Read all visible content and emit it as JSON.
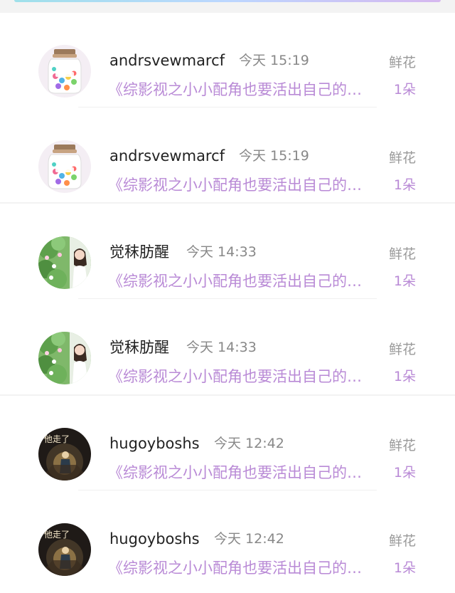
{
  "messages": [
    {
      "user": "andrsvewmarcf",
      "time": "今天 15:19",
      "gift_label": "鲜花",
      "book_title": "《综影视之小小配角也要活出自己的…",
      "count": "1朵",
      "avatar": "candy-jar-avatar"
    },
    {
      "user": "andrsvewmarcf",
      "time": "今天 15:19",
      "gift_label": "鲜花",
      "book_title": "《综影视之小小配角也要活出自己的…",
      "count": "1朵",
      "avatar": "candy-jar-avatar"
    },
    {
      "user": "觉秣肪醒",
      "time": "今天 14:33",
      "gift_label": "鲜花",
      "book_title": "《综影视之小小配角也要活出自己的…",
      "count": "1朵",
      "avatar": "girl-flowers-avatar"
    },
    {
      "user": "觉秣肪醒",
      "time": "今天 14:33",
      "gift_label": "鲜花",
      "book_title": "《综影视之小小配角也要活出自己的…",
      "count": "1朵",
      "avatar": "girl-flowers-avatar"
    },
    {
      "user": "hugoyboshs",
      "time": "今天 12:42",
      "gift_label": "鲜花",
      "book_title": "《综影视之小小配角也要活出自己的…",
      "count": "1朵",
      "avatar": "night-figure-avatar"
    },
    {
      "user": "hugoyboshs",
      "time": "今天 12:42",
      "gift_label": "鲜花",
      "book_title": "《综影视之小小配角也要活出自己的…",
      "count": "1朵",
      "avatar": "night-figure-avatar"
    }
  ],
  "avatar_text": "他走了",
  "colors": {
    "title_purple": "#b98ad6",
    "name_text": "#222222",
    "time_text": "#888888",
    "label_gray": "#9a9a9a"
  }
}
